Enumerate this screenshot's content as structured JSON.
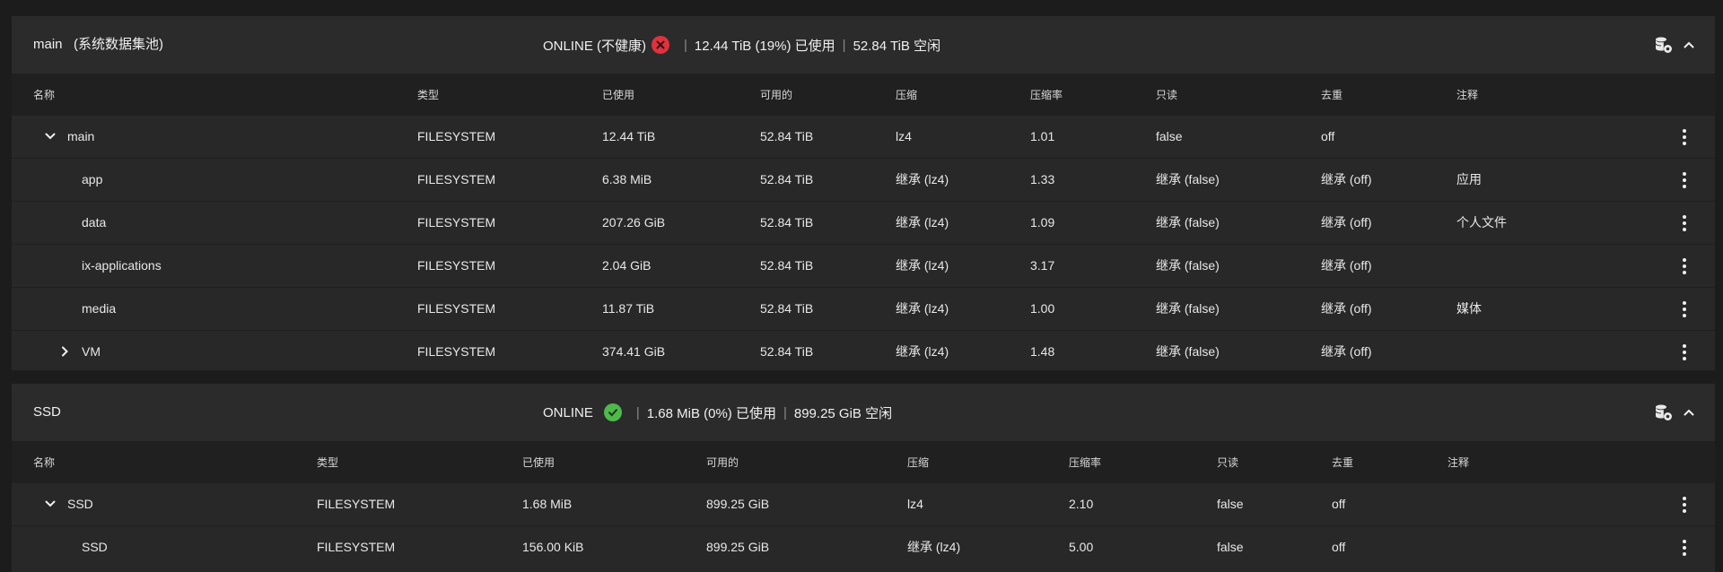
{
  "pools": {
    "main": {
      "name": "main",
      "subtitle": "(系统数据集池)",
      "status": "ONLINE (不健康)",
      "used": "12.44 TiB (19%) 已使用",
      "free": "52.84 TiB 空闲",
      "columns": [
        "名称",
        "类型",
        "已使用",
        "可用的",
        "压缩",
        "压缩率",
        "只读",
        "去重",
        "注释"
      ],
      "rows": [
        {
          "name": "main",
          "type": "FILESYSTEM",
          "used": "12.44 TiB",
          "avail": "52.84 TiB",
          "compress": "lz4",
          "ratio": "1.01",
          "readonly": "false",
          "dedup": "off",
          "comment": ""
        },
        {
          "name": "app",
          "type": "FILESYSTEM",
          "used": "6.38 MiB",
          "avail": "52.84 TiB",
          "compress": "继承 (lz4)",
          "ratio": "1.33",
          "readonly": "继承 (false)",
          "dedup": "继承 (off)",
          "comment": "应用"
        },
        {
          "name": "data",
          "type": "FILESYSTEM",
          "used": "207.26 GiB",
          "avail": "52.84 TiB",
          "compress": "继承 (lz4)",
          "ratio": "1.09",
          "readonly": "继承 (false)",
          "dedup": "继承 (off)",
          "comment": "个人文件"
        },
        {
          "name": "ix-applications",
          "type": "FILESYSTEM",
          "used": "2.04 GiB",
          "avail": "52.84 TiB",
          "compress": "继承 (lz4)",
          "ratio": "3.17",
          "readonly": "继承 (false)",
          "dedup": "继承 (off)",
          "comment": ""
        },
        {
          "name": "media",
          "type": "FILESYSTEM",
          "used": "11.87 TiB",
          "avail": "52.84 TiB",
          "compress": "继承 (lz4)",
          "ratio": "1.00",
          "readonly": "继承 (false)",
          "dedup": "继承 (off)",
          "comment": "媒体"
        },
        {
          "name": "VM",
          "type": "FILESYSTEM",
          "used": "374.41 GiB",
          "avail": "52.84 TiB",
          "compress": "继承 (lz4)",
          "ratio": "1.48",
          "readonly": "继承 (false)",
          "dedup": "继承 (off)",
          "comment": ""
        }
      ]
    },
    "ssd": {
      "name": "SSD",
      "status": "ONLINE",
      "used": "1.68 MiB (0%) 已使用",
      "free": "899.25 GiB 空闲",
      "columns": [
        "名称",
        "类型",
        "已使用",
        "可用的",
        "压缩",
        "压缩率",
        "只读",
        "去重",
        "注释"
      ],
      "rows": [
        {
          "name": "SSD",
          "type": "FILESYSTEM",
          "used": "1.68 MiB",
          "avail": "899.25 GiB",
          "compress": "lz4",
          "ratio": "2.10",
          "readonly": "false",
          "dedup": "off",
          "comment": ""
        },
        {
          "name": "SSD",
          "type": "FILESYSTEM",
          "used": "156.00 KiB",
          "avail": "899.25 GiB",
          "compress": "继承 (lz4)",
          "ratio": "5.00",
          "readonly": "false",
          "dedup": "off",
          "comment": ""
        }
      ]
    }
  },
  "icons": {
    "error": "close-circle-icon",
    "ok": "check-circle-icon",
    "pool_settings": "database-gear-icon",
    "collapse": "chevron-up-icon",
    "expand_open": "chevron-down-icon",
    "expand_closed": "chevron-right-icon",
    "more": "more-vertical-icon"
  },
  "colors": {
    "error": "#e0313e",
    "ok": "#4fb94c",
    "background": "#1c1c1c",
    "panel": "#282828"
  }
}
